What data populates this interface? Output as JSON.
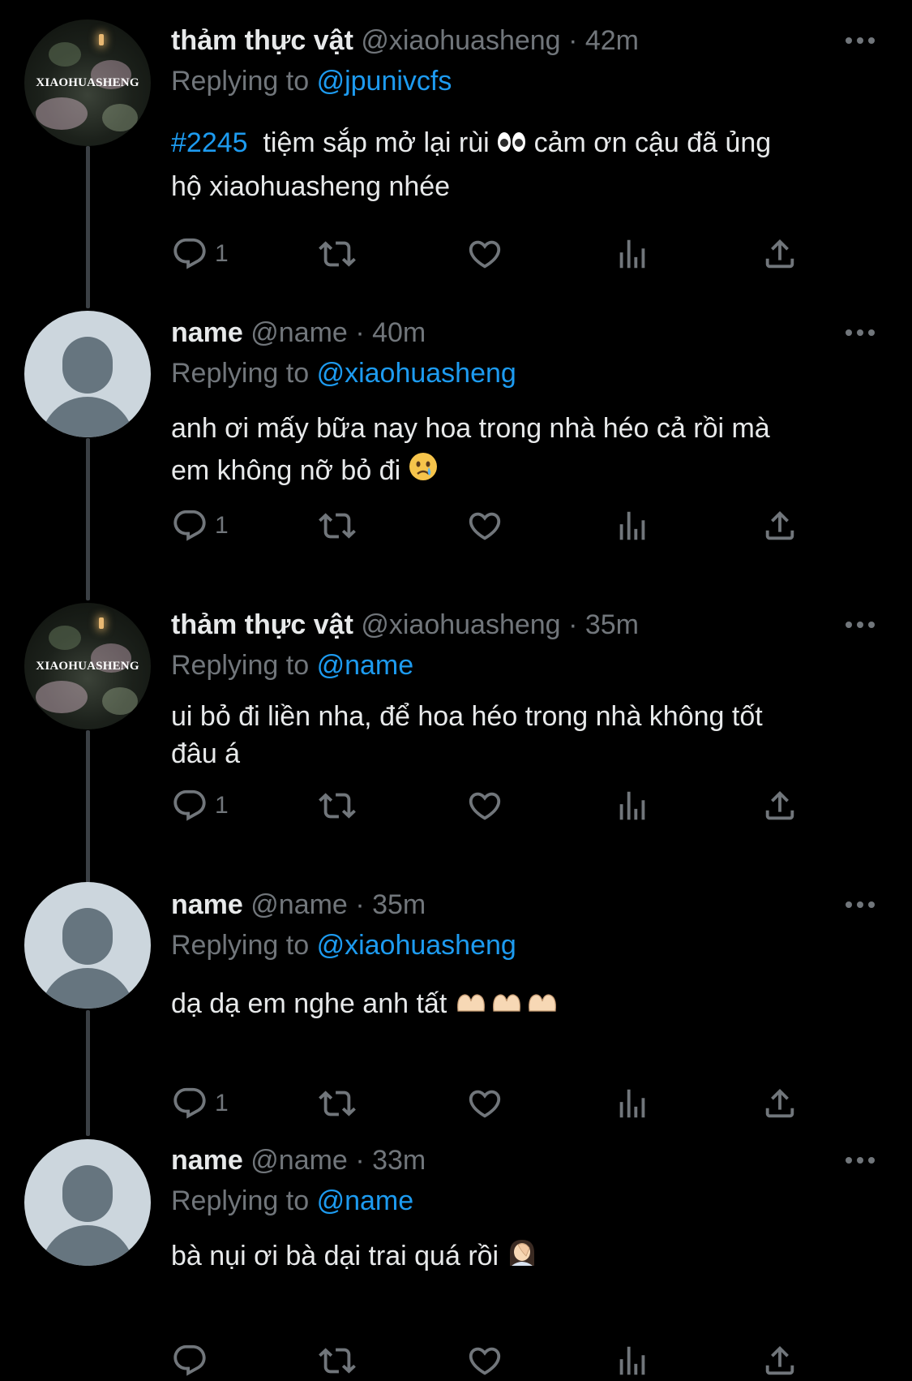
{
  "colors": {
    "background": "#000000",
    "text": "#e7e9ea",
    "secondary": "#71767b",
    "accent": "#1d9bf0",
    "thread_line": "#3b4045"
  },
  "tweets": [
    {
      "display_name": "thảm thực vật",
      "handle": "@xiaohuasheng",
      "time": "· 42m",
      "avatar": "xiaohuasheng-logo",
      "avatar_logo_text": "XIAOHUASHENG",
      "reply_prefix": "Replying to",
      "reply_to": "@jpunivcfs",
      "hashtag": "#2245",
      "text_line1": "tiệm sắp mở lại rùi",
      "emoji1": "eyes-emoji",
      "text_line1b": "cảm ơn cậu đã ủng",
      "text_line2": "hộ xiaohuasheng nhée",
      "reply_count": "1"
    },
    {
      "display_name": "name",
      "handle": "@name",
      "time": "· 40m",
      "avatar": "default-avatar",
      "reply_prefix": "Replying to",
      "reply_to": "@xiaohuasheng",
      "text_line1": "anh ơi mấy bữa nay hoa trong nhà héo cả rồi mà",
      "text_line2": "em không nỡ bỏ đi",
      "emoji1": "crying-face-emoji",
      "reply_count": "1"
    },
    {
      "display_name": "thảm thực vật",
      "handle": "@xiaohuasheng",
      "time": "· 35m",
      "avatar": "xiaohuasheng-logo",
      "avatar_logo_text": "XIAOHUASHENG",
      "reply_prefix": "Replying to",
      "reply_to": "@name",
      "text_line1": "ui bỏ đi liền nha, để hoa héo trong nhà không tốt",
      "text_line2": "đâu á",
      "reply_count": "1"
    },
    {
      "display_name": "name",
      "handle": "@name",
      "time": "· 35m",
      "avatar": "default-avatar",
      "reply_prefix": "Replying to",
      "reply_to": "@xiaohuasheng",
      "text_line1": "dạ dạ em nghe anh tất",
      "emoji1": "heart-hands-emoji",
      "reply_count": "1"
    },
    {
      "display_name": "name",
      "handle": "@name",
      "time": "· 33m",
      "avatar": "default-avatar",
      "reply_prefix": "Replying to",
      "reply_to": "@name",
      "text_line1": "bà nụi ơi bà dại trai quá rồi",
      "emoji1": "facepalm-emoji",
      "reply_count": ""
    }
  ],
  "icons": {
    "reply": "reply-icon",
    "retweet": "retweet-icon",
    "like": "heart-icon",
    "views": "views-icon",
    "share": "share-icon",
    "more": "more-icon"
  }
}
